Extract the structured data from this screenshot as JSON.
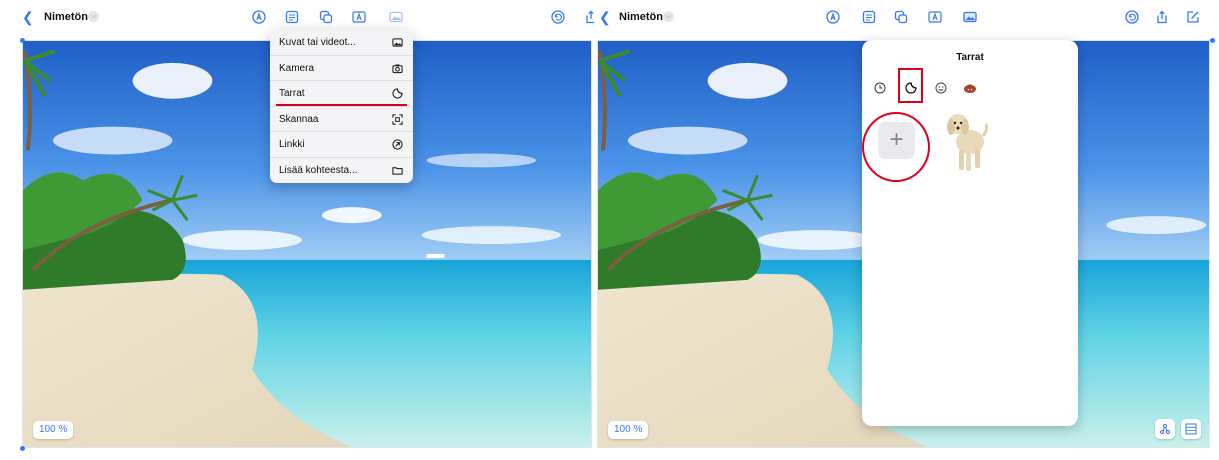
{
  "left": {
    "title": "Nimetön",
    "zoom": "100 %",
    "menu": {
      "items": [
        {
          "label": "Kuvat tai videot...",
          "icon": "photo-icon"
        },
        {
          "label": "Kamera",
          "icon": "camera-icon"
        },
        {
          "label": "Tarrat",
          "icon": "sticker-icon"
        },
        {
          "label": "Skannaa",
          "icon": "scan-icon"
        },
        {
          "label": "Linkki",
          "icon": "link-icon"
        },
        {
          "label": "Lisää kohteesta...",
          "icon": "folder-icon"
        }
      ]
    },
    "toolbar_icons": [
      "pen-icon",
      "text-box-icon",
      "shapes-icon",
      "text-icon",
      "media-icon",
      "undo-icon"
    ]
  },
  "right": {
    "title": "Nimetön",
    "zoom": "100 %",
    "sticker_panel": {
      "title": "Tarrat",
      "categories": [
        "recents-icon",
        "stickers-icon",
        "emoji-icon",
        "memoji-icon"
      ],
      "add_label": "+"
    },
    "toolbar_icons": [
      "pen-icon",
      "text-box-icon",
      "shapes-icon",
      "text-icon",
      "media-icon",
      "undo-icon",
      "share-icon",
      "compose-icon"
    ]
  },
  "colors": {
    "accent": "#3478f6",
    "annotation": "#e0001b",
    "background": "#c6d4f0"
  }
}
